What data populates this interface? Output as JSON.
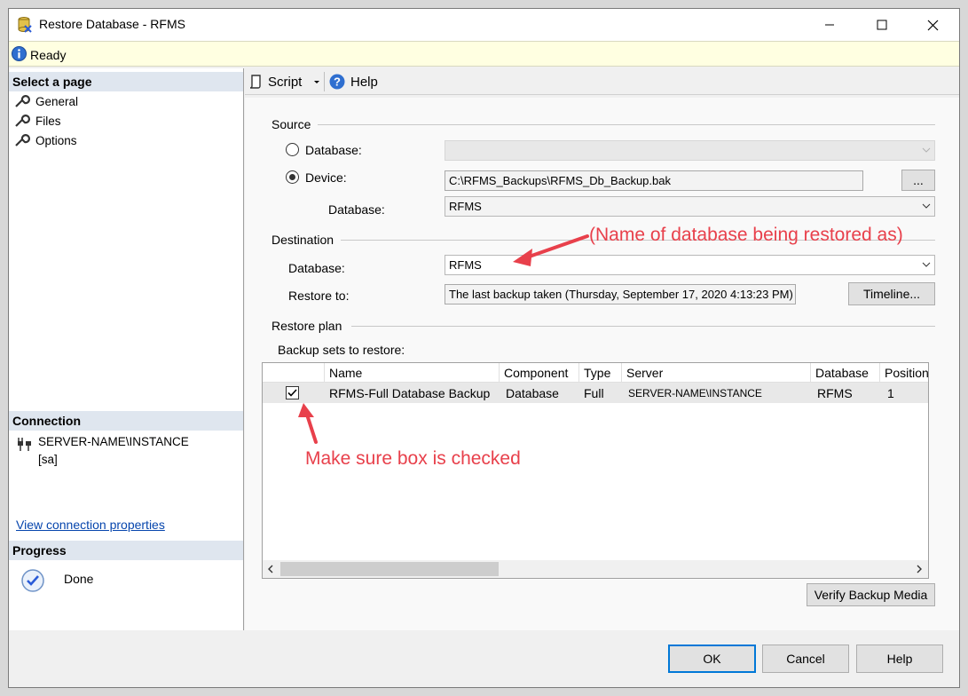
{
  "window": {
    "title": "Restore Database - RFMS",
    "minimize_label": "—",
    "maximize_label": "☐",
    "close_label": "✕"
  },
  "status": {
    "text": "Ready"
  },
  "left": {
    "select_page_header": "Select a page",
    "pages": [
      {
        "label": "General"
      },
      {
        "label": "Files"
      },
      {
        "label": "Options"
      }
    ],
    "connection_header": "Connection",
    "server": "SERVER-NAME\\INSTANCE",
    "login": "[sa]",
    "view_connection_link": "View connection properties",
    "progress_header": "Progress",
    "progress_status": "Done"
  },
  "toolbar": {
    "script_label": "Script",
    "help_label": "Help"
  },
  "source": {
    "group_label": "Source",
    "database_radio_label": "Database:",
    "device_radio_label": "Device:",
    "device_path": "C:\\RFMS_Backups\\RFMS_Db_Backup.bak",
    "browse_label": "...",
    "database_label": "Database:",
    "database_value": "RFMS"
  },
  "destination": {
    "group_label": "Destination",
    "database_label": "Database:",
    "database_value": "RFMS",
    "restore_to_label": "Restore to:",
    "restore_to_value": "The last backup taken (Thursday, September 17, 2020 4:13:23 PM)",
    "timeline_label": "Timeline..."
  },
  "restore_plan": {
    "group_label": "Restore plan",
    "backup_sets_label": "Backup sets to restore:",
    "columns": [
      "Name",
      "Component",
      "Type",
      "Server",
      "Database",
      "Position"
    ],
    "rows": [
      {
        "restore": true,
        "name": "RFMS-Full Database Backup",
        "component": "Database",
        "type": "Full",
        "server": "SERVER-NAME\\INSTANCE",
        "database": "RFMS",
        "position": "1"
      }
    ],
    "verify_label": "Verify Backup Media"
  },
  "buttons": {
    "ok": "OK",
    "cancel": "Cancel",
    "help": "Help"
  },
  "annotations": {
    "destination_note": "(Name of database being restored as)",
    "checkbox_note": "Make sure box is checked",
    "color": "#e8404b"
  }
}
